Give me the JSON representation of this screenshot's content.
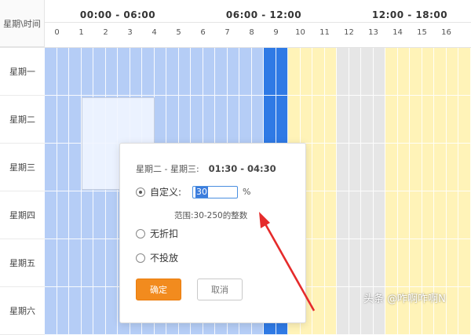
{
  "header": {
    "corner_label": "星期\\时间",
    "blocks": [
      "00:00 - 06:00",
      "06:00 - 12:00",
      "12:00 - 18:00"
    ],
    "hours": [
      "0",
      "1",
      "2",
      "3",
      "4",
      "5",
      "6",
      "7",
      "8",
      "9",
      "10",
      "11",
      "12",
      "13",
      "14",
      "15",
      "16"
    ]
  },
  "days": [
    "星期一",
    "星期二",
    "星期三",
    "星期四",
    "星期五",
    "星期六"
  ],
  "colors": {
    "light_blue": "#b5cdf6",
    "dark_blue": "#2f7ae5",
    "yellow": "#fff3b8",
    "gray": "#e6e6e6",
    "white": "#ffffff"
  },
  "schedule_column_states": [
    "light_blue",
    "light_blue",
    "light_blue",
    "light_blue",
    "light_blue",
    "light_blue",
    "light_blue",
    "light_blue",
    "light_blue",
    "dark_blue",
    "yellow",
    "yellow",
    "gray",
    "gray",
    "yellow",
    "yellow",
    "yellow",
    "yellow"
  ],
  "popup": {
    "title": "星期二 - 星期三:",
    "time_range": "01:30 - 04:30",
    "option_custom": "自定义:",
    "custom_value": "30",
    "percent_unit": "%",
    "range_hint": "范围:30-250的整数",
    "option_no_discount": "无折扣",
    "option_no_delivery": "不投放",
    "confirm_label": "确定",
    "cancel_label": "取消"
  },
  "watermark": "头条 @咋啊咋啊N"
}
